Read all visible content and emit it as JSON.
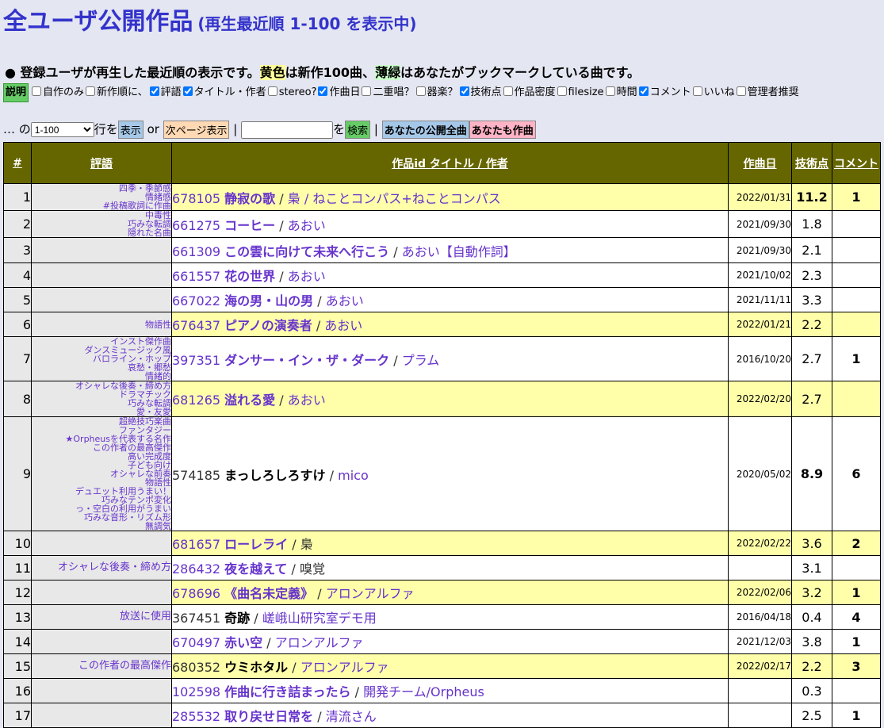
{
  "header": {
    "title": "全ユーザ公開作品",
    "subtitle": "(再生最近順 1-100 を表示中)"
  },
  "desc": {
    "bullet": "●",
    "part1": "登録ユーザが再生した最近順の表示です。",
    "yellow": "黄色",
    "part2": "は新作100曲、",
    "green": "薄緑",
    "part3": "はあなたがブックマークしている曲です。"
  },
  "options": {
    "explain_label": "説明",
    "items": [
      {
        "label": "自作のみ",
        "checked": false
      },
      {
        "label": "新作順に、",
        "checked": false
      },
      {
        "label": "評語",
        "checked": true
      },
      {
        "label": "タイトル・作者",
        "checked": true
      },
      {
        "label": "stereo?",
        "checked": false
      },
      {
        "label": "作曲日",
        "checked": true
      },
      {
        "label": "二重唱？",
        "checked": false
      },
      {
        "label": "器楽？",
        "checked": false
      },
      {
        "label": "技術点",
        "checked": true
      },
      {
        "label": "作品密度",
        "checked": false
      },
      {
        "label": "filesize",
        "checked": false
      },
      {
        "label": "時間",
        "checked": false
      },
      {
        "label": "コメント",
        "checked": true
      },
      {
        "label": "いいね",
        "checked": false
      },
      {
        "label": "管理者推奨",
        "checked": false
      }
    ]
  },
  "controls": {
    "prefix": "… の",
    "range_value": "1-100",
    "rows_label": "行を",
    "show_label": "表示",
    "or_label": "or",
    "next_label": "次ページ表示",
    "sep": "|",
    "search_value": "",
    "wo_label": "を",
    "search_label": "検索",
    "mine_label": "あなたの公開全曲",
    "same_label": "あなたも作曲"
  },
  "table": {
    "headers": {
      "num": "#",
      "comment": "評語",
      "work": "作品id タイトル / 作者",
      "date": "作曲日",
      "score": "技術点",
      "cmt": "コメント"
    },
    "rows": [
      {
        "num": "1",
        "comments": [
          "四季・季節感",
          "情緒感",
          "#投稿歌詞に作曲"
        ],
        "id": "678105",
        "title": "静寂の歌",
        "author": "梟 / ねことコンパス+ねことコンパス",
        "date": "2022/01/31",
        "score": "11.2",
        "cmt": "1",
        "new": true
      },
      {
        "num": "2",
        "comments": [
          "中毒性",
          "巧みな転調",
          "隠れた名曲"
        ],
        "id": "661275",
        "title": "コーヒー",
        "author": "あおい",
        "date": "2021/09/30",
        "score": "1.8",
        "cmt": "",
        "new": false
      },
      {
        "num": "3",
        "comments": [],
        "id": "661309",
        "title": "この雲に向けて未来へ行こう",
        "author": "あおい【自動作詞】",
        "date": "2021/09/30",
        "score": "2.1",
        "cmt": "",
        "new": false
      },
      {
        "num": "4",
        "comments": [],
        "id": "661557",
        "title": "花の世界",
        "author": "あおい",
        "date": "2021/10/02",
        "score": "2.3",
        "cmt": "",
        "new": false
      },
      {
        "num": "5",
        "comments": [],
        "id": "667022",
        "title": "海の男・山の男",
        "author": "あおい",
        "date": "2021/11/11",
        "score": "3.3",
        "cmt": "",
        "new": false
      },
      {
        "num": "6",
        "comments": [
          "物語性"
        ],
        "id": "676437",
        "title": "ピアノの演奏者",
        "author": "あおい",
        "date": "2022/01/21",
        "score": "2.2",
        "cmt": "",
        "new": true
      },
      {
        "num": "7",
        "comments": [
          "インスト傑作曲",
          "ダンスミュージック風",
          "バロライン・ホップ",
          "哀愁・郷愁",
          "情緒的"
        ],
        "id": "397351",
        "title": "ダンサー・イン・ザ・ダーク",
        "author": "プラム",
        "date": "2016/10/20",
        "score": "2.7",
        "cmt": "1",
        "new": false
      },
      {
        "num": "8",
        "comments": [
          "オシャレな後奏・締め方",
          "ドラマチック",
          "巧みな転調",
          "愛・友愛"
        ],
        "id": "681265",
        "title": "溢れる愛",
        "author": "あおい",
        "date": "2022/02/20",
        "score": "2.7",
        "cmt": "",
        "new": true
      },
      {
        "num": "9",
        "comments": [
          "超絶技巧楽曲",
          "ファンタジー",
          "★Orpheusを代表する名作",
          "この作者の最高傑作",
          "高い完成度",
          "子ども向け",
          "オシャレな前奏",
          "物語性",
          "デュエット利用うまい！",
          "巧みなテンポ変化",
          "っ・空白の利用がうまい",
          "巧みな音形・リズム形",
          "無調気"
        ],
        "id": "574185",
        "title": "まっしろしろすけ",
        "author": "mico",
        "date": "2020/05/02",
        "score": "8.9",
        "cmt": "6",
        "new": false,
        "black": true
      },
      {
        "num": "10",
        "comments": [],
        "id": "681657",
        "title": "ローレライ",
        "author": "梟",
        "date": "2022/02/22",
        "score": "3.6",
        "cmt": "2",
        "new": true,
        "authorBlack": true
      },
      {
        "num": "11",
        "comments": [
          "オシャレな後奏・締め方"
        ],
        "id": "286432",
        "title": "夜を越えて",
        "author": "嗅覚",
        "date": "",
        "score": "3.1",
        "cmt": "",
        "new": false,
        "authorBlack": true,
        "bigComment": true
      },
      {
        "num": "12",
        "comments": [],
        "id": "678696",
        "title": "《曲名未定義》",
        "author": "アロンアルファ",
        "date": "2022/02/06",
        "score": "3.2",
        "cmt": "1",
        "new": true
      },
      {
        "num": "13",
        "comments": [
          "放送に使用"
        ],
        "id": "367451",
        "title": "奇跡",
        "author": "嵯峨山研究室デモ用",
        "date": "2016/04/18",
        "score": "0.4",
        "cmt": "4",
        "new": false,
        "black": true,
        "bigComment": true
      },
      {
        "num": "14",
        "comments": [],
        "id": "670497",
        "title": "赤い空",
        "author": "アロンアルファ",
        "date": "2021/12/03",
        "score": "3.8",
        "cmt": "1",
        "new": false
      },
      {
        "num": "15",
        "comments": [
          "この作者の最高傑作"
        ],
        "id": "680352",
        "title": "ウミホタル",
        "author": "アロンアルファ",
        "date": "2022/02/17",
        "score": "2.2",
        "cmt": "3",
        "new": true,
        "idBlack": true,
        "titleBlack": true,
        "bigComment": true
      },
      {
        "num": "16",
        "comments": [],
        "id": "102598",
        "title": "作曲に行き詰まったら",
        "author": "開発チーム/Orpheus",
        "date": "",
        "score": "0.3",
        "cmt": "",
        "new": false
      },
      {
        "num": "17",
        "comments": [],
        "id": "285532",
        "title": "取り戻せ日常を",
        "author": "清流さん",
        "date": "",
        "score": "2.5",
        "cmt": "1",
        "new": false
      }
    ]
  },
  "colors": {
    "title": "#3333cc",
    "link": "#6633cc",
    "header_bg": "#666600",
    "new_row": "#ffffaa"
  }
}
